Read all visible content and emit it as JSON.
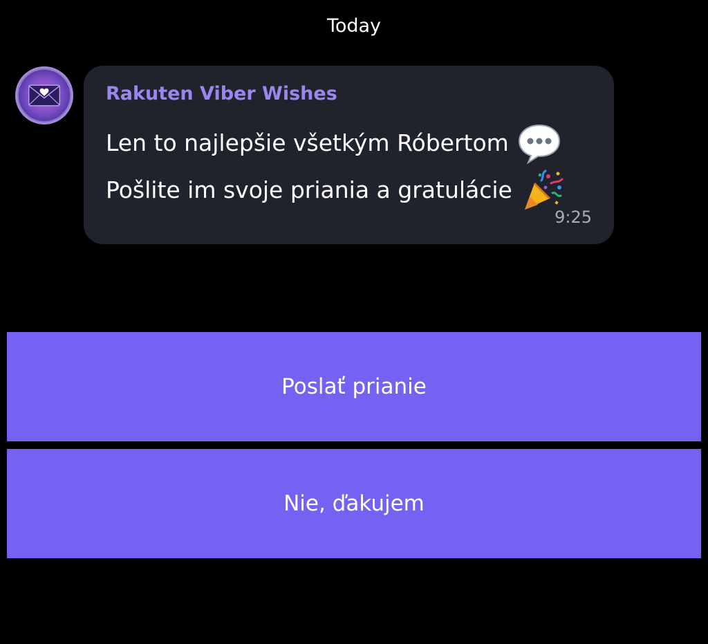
{
  "chat": {
    "date_separator": "Today",
    "message": {
      "sender": "Rakuten Viber Wishes",
      "line1": "Len to najlepšie všetkým Róbertom",
      "line1_emoji": "speech-bubble-icon",
      "line2": "Pošlite im svoje priania a gratulácie",
      "line2_emoji": "party-popper-icon",
      "time": "9:25"
    }
  },
  "actions": {
    "primary_label": "Poslať prianie",
    "secondary_label": "Nie, ďakujem"
  },
  "colors": {
    "background": "#000000",
    "bubble": "#20232b",
    "sender": "#9a86ee",
    "button": "#7561f2",
    "time": "#a9acb4"
  }
}
